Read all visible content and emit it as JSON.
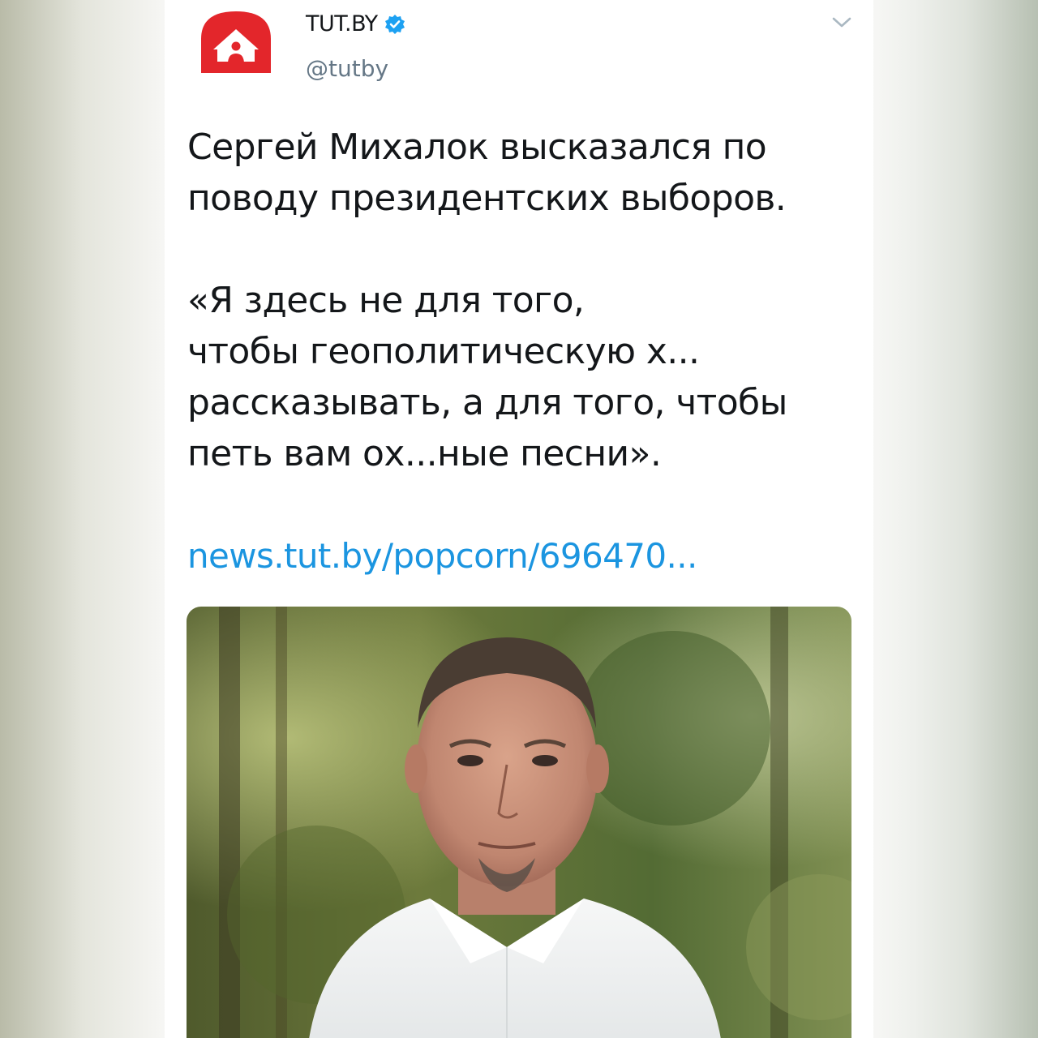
{
  "author": {
    "name": "TUT.BY",
    "handle": "@tutby",
    "verified": true
  },
  "tweet": {
    "lines": [
      "Сергей Михалок высказался по",
      "поводу президентских выборов.",
      "",
      "«Я здесь не для того,",
      "чтобы геополитическую х...",
      "рассказывать, а для того, чтобы",
      "петь вам ох...ные песни»."
    ],
    "link": "news.tut.by/popcorn/696470..."
  },
  "icons": {
    "logo": "tutby-logo-icon",
    "verified": "verified-badge-icon",
    "menu": "chevron-down-icon"
  },
  "colors": {
    "brand_red": "#e3262b",
    "link": "#1b95e0",
    "verified": "#1da1f2",
    "text": "#14171a",
    "muted": "#657786"
  }
}
